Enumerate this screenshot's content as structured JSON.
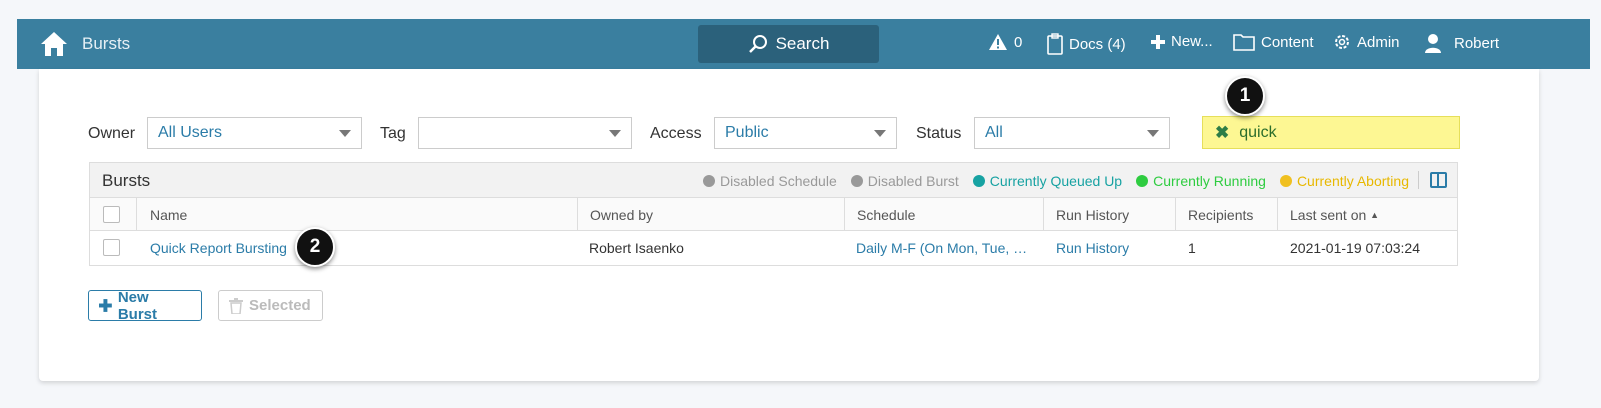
{
  "topbar": {
    "title": "Bursts",
    "search_label": "Search",
    "alerts_count": "0",
    "docs_label": "Docs (4)",
    "new_label": "New...",
    "content_label": "Content",
    "admin_label": "Admin",
    "user_label": "Robert"
  },
  "filters": {
    "owner_label": "Owner",
    "owner_value": "All Users",
    "tag_label": "Tag",
    "tag_value": "",
    "access_label": "Access",
    "access_value": "Public",
    "status_label": "Status",
    "status_value": "All",
    "search_value": "quick"
  },
  "table": {
    "title": "Bursts",
    "legend": [
      {
        "label": "Disabled Schedule",
        "color": "#999999"
      },
      {
        "label": "Disabled Burst",
        "color": "#999999"
      },
      {
        "label": "Currently Queued Up",
        "color": "#17a2a2"
      },
      {
        "label": "Currently Running",
        "color": "#2ecc40"
      },
      {
        "label": "Currently Aborting",
        "color": "#f0c020"
      }
    ],
    "columns": [
      "Name",
      "Owned by",
      "Schedule",
      "Run History",
      "Recipients",
      "Last sent on"
    ],
    "sort_indicator": "▲",
    "rows": [
      {
        "name": "Quick Report Bursting",
        "owner": "Robert Isaenko",
        "schedule": "Daily M-F (On Mon, Tue, Wed, Thu, Fri)",
        "run_history": "Run History",
        "recipients": "1",
        "last_sent": "2021-01-19 07:03:24"
      }
    ]
  },
  "actions": {
    "new_burst": "New Burst",
    "delete_selected": "Selected"
  },
  "callouts": [
    "1",
    "2"
  ],
  "colors": {
    "topbar": "#3a7f9f",
    "search_button": "#2b617b",
    "link": "#2b7ca8",
    "highlight": "#fdf793"
  }
}
